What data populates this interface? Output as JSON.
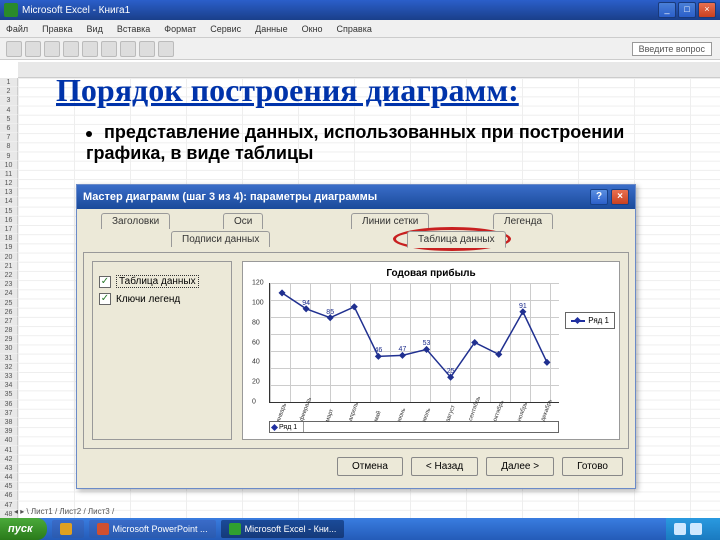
{
  "window": {
    "app_title": "Microsoft Excel - Книга1",
    "question_prompt": "Введите вопрос"
  },
  "menu": {
    "items": [
      "Файл",
      "Правка",
      "Вид",
      "Вставка",
      "Формат",
      "Сервис",
      "Данные",
      "Окно",
      "Справка"
    ]
  },
  "slide": {
    "title": "Порядок построения диаграмм:",
    "bullet": "представление данных, использованных при построении графика, в виде таблицы"
  },
  "wizard": {
    "title": "Мастер диаграмм (шаг 3 из 4): параметры диаграммы",
    "tabs": {
      "titles": "Заголовки",
      "axes": "Оси",
      "gridlines": "Линии сетки",
      "legend": "Легенда",
      "datalabels": "Подписи данных",
      "datatable": "Таблица данных"
    },
    "options": {
      "data_table": "Таблица данных",
      "legend_keys": "Ключи легенд"
    },
    "buttons": {
      "cancel": "Отмена",
      "back": "< Назад",
      "next": "Далее >",
      "finish": "Готово"
    }
  },
  "chart_data": {
    "type": "line",
    "title": "Годовая прибыль",
    "series_name": "Ряд 1",
    "categories": [
      "январь",
      "февраль",
      "март",
      "апрель",
      "май",
      "июнь",
      "июль",
      "август",
      "сентябрь",
      "октябрь",
      "ноябрь",
      "декабрь"
    ],
    "values": [
      110,
      94,
      85,
      96,
      46,
      47,
      53,
      25,
      60,
      48,
      91,
      40
    ],
    "labeled_points": {
      "1": 94,
      "2": 85,
      "4": 46,
      "5": 47,
      "6": 53,
      "7": 25,
      "10": 91
    },
    "ylim": [
      0,
      120
    ],
    "yticks": [
      0,
      20,
      40,
      60,
      80,
      100,
      120
    ],
    "xlabel": "",
    "ylabel": ""
  },
  "sheet_tabs": "Лист1 / Лист2 / Лист3 /",
  "taskbar": {
    "start": "пуск",
    "items": [
      "",
      "Microsoft PowerPoint ...",
      "Microsoft Excel - Кни..."
    ],
    "clock": ""
  }
}
